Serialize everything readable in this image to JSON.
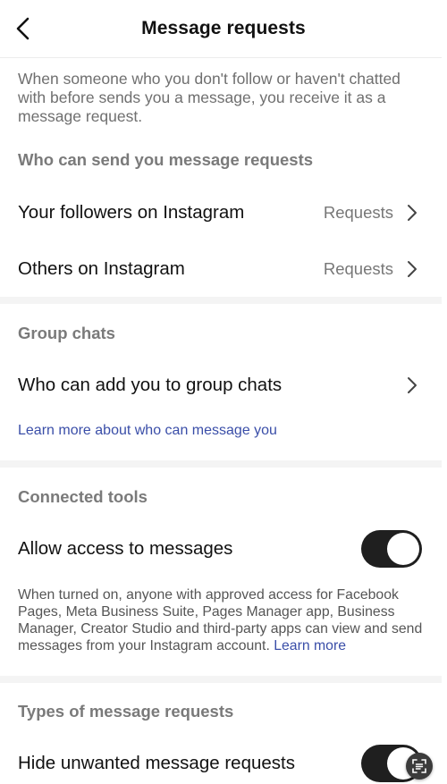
{
  "header": {
    "title": "Message requests",
    "back_icon": "chevron-left-icon"
  },
  "intro_text": "When someone who you don't follow or haven't chatted with before sends you a message, you receive it as a message request.",
  "who_can_send": {
    "heading": "Who can send you message requests",
    "items": [
      {
        "label": "Your followers on Instagram",
        "value": "Requests"
      },
      {
        "label": "Others on Instagram",
        "value": "Requests"
      }
    ]
  },
  "group_chats": {
    "heading": "Group chats",
    "item_label": "Who can add you to group chats",
    "learn_more": "Learn more about who can message you"
  },
  "connected_tools": {
    "heading": "Connected tools",
    "item_label": "Allow access to messages",
    "toggle_on": true,
    "description": "When turned on, anyone with approved access for Facebook Pages, Meta Business Suite, Pages Manager app, Business Manager, Creator Studio and third-party apps can view and send messages from your Instagram account.",
    "learn_more": "Learn more"
  },
  "types": {
    "heading": "Types of message requests",
    "item_label": "Hide unwanted message requests",
    "toggle_on": true
  },
  "colors": {
    "link": "#3a4ea8",
    "toggle_on": "#1f1f1f"
  }
}
